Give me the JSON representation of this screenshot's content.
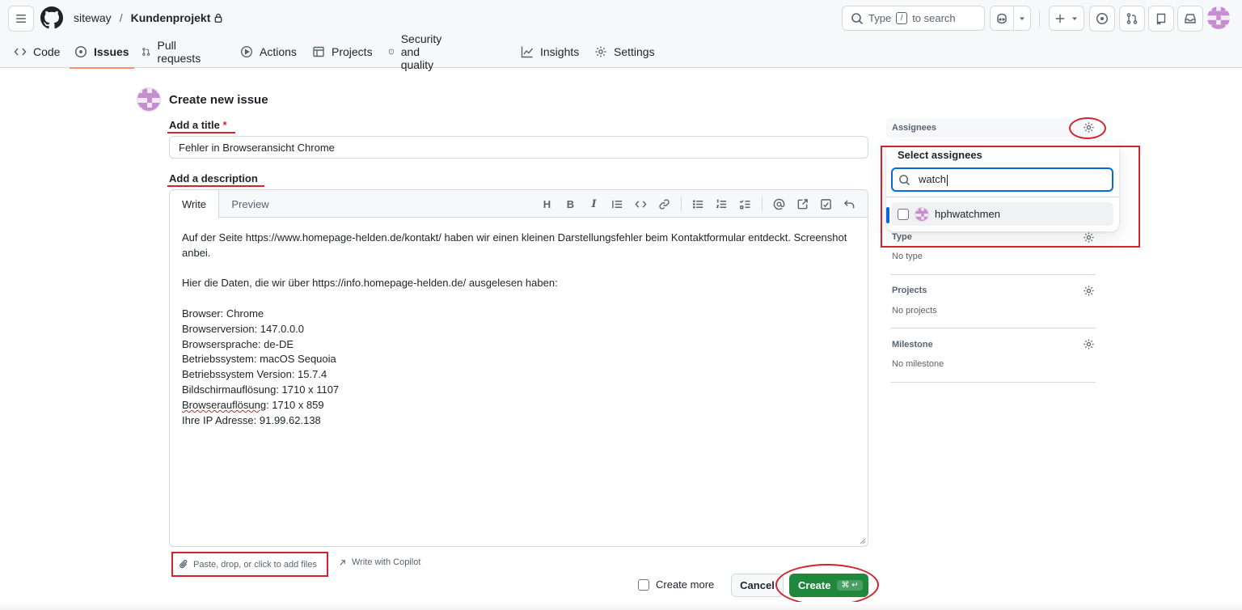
{
  "header": {
    "owner": "siteway",
    "separator": "/",
    "repo": "Kundenprojekt",
    "search_text": "Type",
    "search_key": "/",
    "search_suffix": "to search"
  },
  "nav": {
    "items": [
      {
        "label": "Code",
        "icon": "code-icon"
      },
      {
        "label": "Issues",
        "icon": "issue-opened-icon",
        "active": true
      },
      {
        "label": "Pull requests",
        "icon": "git-pull-request-icon"
      },
      {
        "label": "Actions",
        "icon": "play-icon"
      },
      {
        "label": "Projects",
        "icon": "table-icon"
      },
      {
        "label": "Security and quality",
        "icon": "shield-icon"
      },
      {
        "label": "Insights",
        "icon": "graph-icon"
      },
      {
        "label": "Settings",
        "icon": "gear-icon"
      }
    ]
  },
  "form": {
    "page_title": "Create new issue",
    "title_label": "Add a title",
    "required_mark": "*",
    "title_value": "Fehler in Browseransicht Chrome",
    "description_label": "Add a description",
    "tab_write": "Write",
    "tab_preview": "Preview",
    "toolbar_heading": "H",
    "toolbar_bold": "B",
    "toolbar_italic": "I",
    "body_lines": [
      "Auf der Seite https://www.homepage-helden.de/kontakt/ haben wir einen kleinen Darstellungsfehler beim Kontaktformular entdeckt. Screenshot",
      "anbei.",
      "",
      "Hier die Daten, die wir über https://info.homepage-helden.de/ ausgelesen haben:",
      "",
      "Browser: Chrome",
      "Browserversion: 147.0.0.0",
      "Browsersprache: de-DE",
      "Betriebssystem: macOS Sequoia",
      "Betriebssystem Version: 15.7.4",
      "Bildschirmauflösung: 1710 x 1107",
      "",
      "Ihre IP Adresse: 91.99.62.138"
    ],
    "browser_res_word": "Browserauflösung",
    "browser_res_rest": ": 1710 x 859",
    "attach_text": "Paste, drop, or click to add files",
    "copilot_text": "Write with Copilot",
    "create_more": "Create more",
    "cancel": "Cancel",
    "create": "Create",
    "create_shortcut": "⌘ ↵"
  },
  "sidebar": {
    "assignees_title": "Assignees",
    "popover_title": "Select assignees",
    "search_value": "watch",
    "result_user": "hphwatchmen",
    "type_title": "Type",
    "type_value": "No type",
    "projects_title": "Projects",
    "projects_value": "No projects",
    "milestone_title": "Milestone",
    "milestone_value": "No milestone"
  },
  "colors": {
    "accent_blue": "#0969da",
    "primary_green": "#1f883d",
    "annotation_red": "#d1242f",
    "nav_underline": "#fd8c73"
  }
}
